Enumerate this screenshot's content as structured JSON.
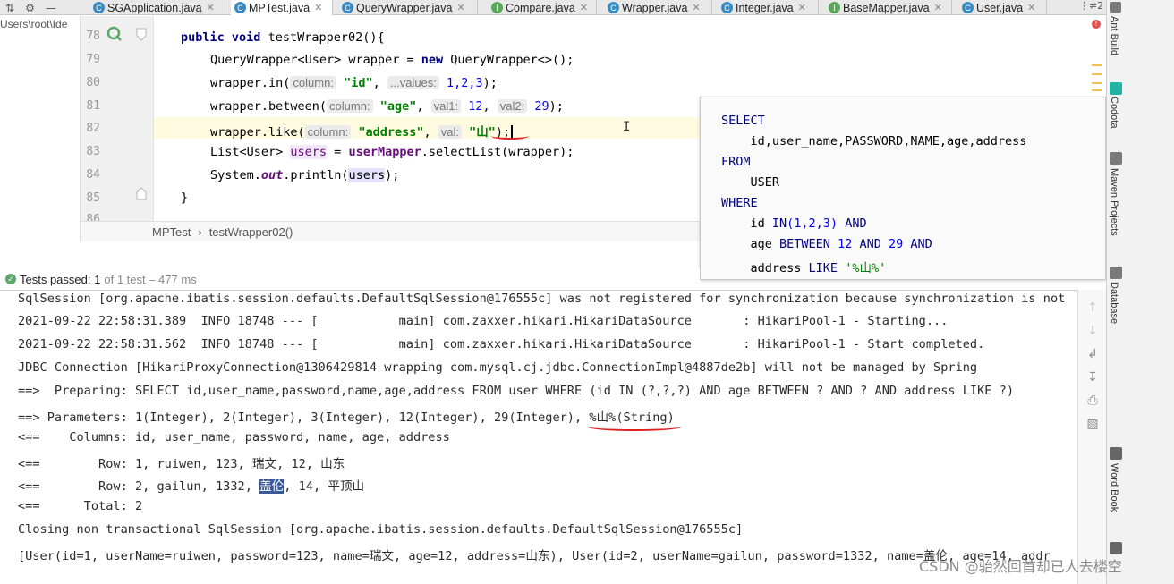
{
  "project": {
    "path_fragment": "Users\\root\\Ide"
  },
  "tabs": [
    {
      "label": "SGApplication.java",
      "active": false
    },
    {
      "label": "MPTest.java",
      "active": true
    },
    {
      "label": "QueryWrapper.java",
      "active": false
    },
    {
      "label": "Compare.java",
      "active": false
    },
    {
      "label": "Wrapper.java",
      "active": false
    },
    {
      "label": "Integer.java",
      "active": false
    },
    {
      "label": "BaseMapper.java",
      "active": false
    },
    {
      "label": "User.java",
      "active": false
    }
  ],
  "tab_overflow": "⋮≠2",
  "editor": {
    "line_numbers": [
      "78",
      "79",
      "80",
      "81",
      "82",
      "83",
      "84",
      "85",
      "86"
    ],
    "lines": {
      "l78": {
        "kw1": "public",
        "kw2": "void",
        "rest": "testWrapper02(){"
      },
      "l79": {
        "a": "QueryWrapper<User> wrapper = ",
        "kw": "new",
        "b": " QueryWrapper<>();"
      },
      "l80": {
        "a": "wrapper.in(",
        "h1": "column:",
        "s1": "\"id\"",
        "c1": ", ",
        "h2": "...values:",
        "n": "1,2,3",
        "b": ");"
      },
      "l81": {
        "a": "wrapper.between(",
        "h1": "column:",
        "s1": "\"age\"",
        "c1": ", ",
        "h2": "val1:",
        "n1": "12",
        "c2": ", ",
        "h3": "val2:",
        "n2": "29",
        "b": ");"
      },
      "l82": {
        "a": "wrapper.like(",
        "h1": "column:",
        "s1": "\"address\"",
        "c1": ", ",
        "h2": "val:",
        "s2": "\"山\"",
        "b": ");"
      },
      "l83": {
        "a": "List<User> ",
        "v": "users",
        "eq": " = ",
        "f": "userMapper",
        "b": ".selectList(wrapper);"
      },
      "l84": {
        "a": "System.",
        "f": "out",
        "b": ".println(",
        "v": "users",
        "c": ");"
      },
      "l85": {
        "a": "}"
      }
    }
  },
  "breadcrumb": {
    "class": "MPTest",
    "sep": "›",
    "method": "testWrapper02()"
  },
  "sql_popup": {
    "lines": [
      {
        "kw": "SELECT",
        "rest": ""
      },
      {
        "kw": "",
        "rest": "    id,user_name,PASSWORD,NAME,age,address"
      },
      {
        "kw": "FROM",
        "rest": ""
      },
      {
        "kw": "",
        "rest": "    USER"
      },
      {
        "kw": "WHERE",
        "rest": ""
      }
    ],
    "w1": {
      "a": "    id ",
      "k1": "IN",
      "n": "(1,2,3)",
      "k2": " AND"
    },
    "w2": {
      "a": "    age ",
      "k1": "BETWEEN",
      "n1": " 12 ",
      "k2": "AND",
      "n2": " 29 ",
      "k3": "AND"
    },
    "w3": {
      "a": "    address ",
      "k1": "LIKE",
      "s": " '%山%'"
    }
  },
  "run": {
    "status": "Tests passed:",
    "count": "1",
    "meta": "of 1 test – 477 ms"
  },
  "console": {
    "lines": [
      "SqlSession [org.apache.ibatis.session.defaults.DefaultSqlSession@176555c] was not registered for synchronization because synchronization is not",
      "2021-09-22 22:58:31.389  INFO 18748 --- [           main] com.zaxxer.hikari.HikariDataSource       : HikariPool-1 - Starting...",
      "2021-09-22 22:58:31.562  INFO 18748 --- [           main] com.zaxxer.hikari.HikariDataSource       : HikariPool-1 - Start completed.",
      "JDBC Connection [HikariProxyConnection@1306429814 wrapping com.mysql.cj.jdbc.ConnectionImpl@4887de2b] will not be managed by Spring",
      "==>  Preparing: SELECT id,user_name,password,name,age,address FROM user WHERE (id IN (?,?,?) AND age BETWEEN ? AND ? AND address LIKE ?)",
      "==> Parameters: 1(Integer), 2(Integer), 3(Integer), 12(Integer), 29(Integer), %山%(String)",
      "<==    Columns: id, user_name, password, name, age, address",
      "<==        Row: 1, ruiwen, 123, 瑞文, 12, 山东"
    ],
    "row2": {
      "a": "<==        Row: 2, gailun, 1332, ",
      "sel": "盖伦",
      "b": ", 14, 平顶山"
    },
    "lines_after": [
      "<==      Total: 2",
      "Closing non transactional SqlSession [org.apache.ibatis.session.defaults.DefaultSqlSession@176555c]",
      "[User(id=1, userName=ruiwen, password=123, name=瑞文, age=12, address=山东), User(id=2, userName=gailun, password=1332, name=盖伦, age=14, addr"
    ]
  },
  "right_toolbar": {
    "labels": [
      "Ant Build",
      "Codota",
      "Maven Projects",
      "Database",
      "Word Book"
    ]
  },
  "watermark": "CSDN @骀然回首却已人去楼空",
  "colors": {
    "accent_red": "#e02020",
    "selection": "#3b5998",
    "string": "#008000",
    "keyword": "#000080"
  }
}
